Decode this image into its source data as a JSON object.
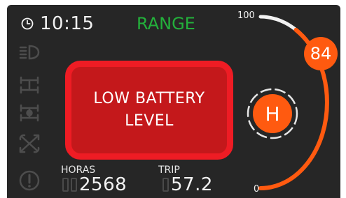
{
  "status_bar": {
    "clock_icon": "clock-icon",
    "time": "10:15",
    "mode": "RANGE"
  },
  "side_icons": [
    "headlight-icon",
    "axle-icon",
    "axle-lock-icon",
    "tools-icon",
    "warning-icon"
  ],
  "alert": {
    "line1": "LOW BATTERY",
    "line2": "LEVEL"
  },
  "battery_gauge": {
    "max_label": "100",
    "min_label": "0",
    "value": 84,
    "value_label": "84"
  },
  "hour_indicator": {
    "label": "H"
  },
  "stats": {
    "hours_label": "HORAS",
    "hours_value": "2568",
    "trip_label": "TRIP",
    "trip_value": "57.2"
  },
  "colors": {
    "background": "#262626",
    "accent": "#ff5a10",
    "alert_fill": "#c4181b",
    "alert_border": "#ee1c24",
    "mode_green": "#23b03b",
    "dim_icon": "#4d4d4d"
  }
}
